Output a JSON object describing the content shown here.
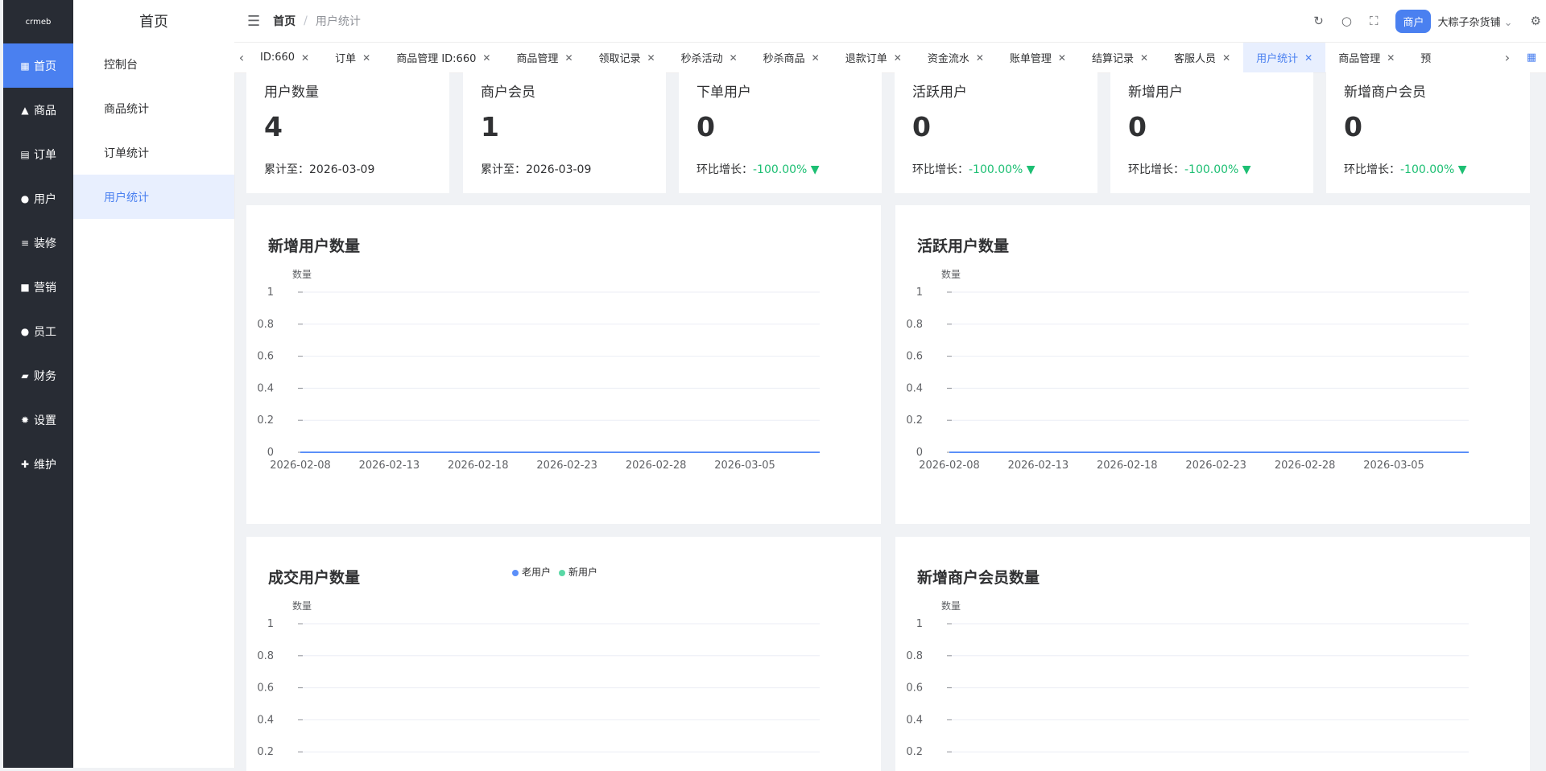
{
  "rail": {
    "logo": "crmeb",
    "items": [
      {
        "label": "首页",
        "icon": "grid-icon",
        "active": true
      },
      {
        "label": "商品",
        "icon": "bag-icon"
      },
      {
        "label": "订单",
        "icon": "doc-icon"
      },
      {
        "label": "用户",
        "icon": "user-icon"
      },
      {
        "label": "装修",
        "icon": "sliders-icon"
      },
      {
        "label": "营销",
        "icon": "shop-icon"
      },
      {
        "label": "员工",
        "icon": "staff-icon"
      },
      {
        "label": "财务",
        "icon": "wallet-icon"
      },
      {
        "label": "设置",
        "icon": "gear-icon"
      },
      {
        "label": "维护",
        "icon": "wrench-icon"
      }
    ]
  },
  "submenu": {
    "title": "首页",
    "items": [
      {
        "label": "控制台"
      },
      {
        "label": "商品统计"
      },
      {
        "label": "订单统计"
      },
      {
        "label": "用户统计",
        "active": true
      }
    ]
  },
  "header": {
    "breadcrumb_home": "首页",
    "breadcrumb_sep": "/",
    "breadcrumb_current": "用户统计",
    "merchant_badge": "商户",
    "shop_name": "大粽子杂货铺"
  },
  "tabs": [
    {
      "label": "ID:660"
    },
    {
      "label": "订单"
    },
    {
      "label": "商品管理 ID:660"
    },
    {
      "label": "商品管理"
    },
    {
      "label": "领取记录"
    },
    {
      "label": "秒杀活动"
    },
    {
      "label": "秒杀商品"
    },
    {
      "label": "退款订单"
    },
    {
      "label": "资金流水"
    },
    {
      "label": "账单管理"
    },
    {
      "label": "结算记录"
    },
    {
      "label": "客服人员"
    },
    {
      "label": "用户统计",
      "active": true
    },
    {
      "label": "商品管理"
    },
    {
      "label": "预"
    }
  ],
  "stats": [
    {
      "label": "用户数量",
      "value": "4",
      "foot_label": "累计至：",
      "foot_value": "2026-03-09"
    },
    {
      "label": "商户会员",
      "value": "1",
      "foot_label": "累计至：",
      "foot_value": "2026-03-09"
    },
    {
      "label": "下单用户",
      "value": "0",
      "foot_label": "环比增长：",
      "foot_value": "-100.00%",
      "trend": "down"
    },
    {
      "label": "活跃用户",
      "value": "0",
      "foot_label": "环比增长：",
      "foot_value": "-100.00%",
      "trend": "down"
    },
    {
      "label": "新增用户",
      "value": "0",
      "foot_label": "环比增长：",
      "foot_value": "-100.00%",
      "trend": "down"
    },
    {
      "label": "新增商户会员",
      "value": "0",
      "foot_label": "环比增长：",
      "foot_value": "-100.00%",
      "trend": "down"
    }
  ],
  "panels": [
    {
      "title": "新增用户数量"
    },
    {
      "title": "活跃用户数量"
    },
    {
      "title": "成交用户数量",
      "legend": [
        {
          "name": "老用户",
          "color": "#5b8ff9"
        },
        {
          "name": "新用户",
          "color": "#5ad8a6"
        }
      ]
    },
    {
      "title": "新增商户会员数量"
    }
  ],
  "chart_data": [
    {
      "type": "line",
      "title": "新增用户数量",
      "ylabel": "数量",
      "ylim": [
        0,
        1
      ],
      "yticks": [
        "1",
        "0.8",
        "0.6",
        "0.4",
        "0.2",
        "0"
      ],
      "xticks": [
        "2026-02-08",
        "2026-02-13",
        "2026-02-18",
        "2026-02-23",
        "2026-02-28",
        "2026-03-05"
      ],
      "series": [
        {
          "color": "#5b8ff9",
          "values": [
            0,
            0
          ]
        }
      ]
    },
    {
      "type": "line",
      "title": "活跃用户数量",
      "ylabel": "数量",
      "ylim": [
        0,
        1
      ],
      "yticks": [
        "1",
        "0.8",
        "0.6",
        "0.4",
        "0.2",
        "0"
      ],
      "xticks": [
        "2026-02-08",
        "2026-02-13",
        "2026-02-18",
        "2026-02-23",
        "2026-02-28",
        "2026-03-05"
      ],
      "series": [
        {
          "color": "#5b8ff9",
          "values": [
            0,
            0
          ]
        }
      ]
    },
    {
      "type": "line",
      "title": "成交用户数量",
      "ylabel": "数量",
      "ylim": [
        0,
        1
      ],
      "yticks": [
        "1",
        "0.8",
        "0.6",
        "0.4",
        "0.2"
      ],
      "xticks": [],
      "series": [
        {
          "name": "老用户",
          "color": "#5b8ff9",
          "values": []
        },
        {
          "name": "新用户",
          "color": "#5ad8a6",
          "values": []
        }
      ]
    },
    {
      "type": "line",
      "title": "新增商户会员数量",
      "ylabel": "数量",
      "ylim": [
        0,
        1
      ],
      "yticks": [
        "1",
        "0.8",
        "0.6",
        "0.4",
        "0.2"
      ],
      "xticks": [],
      "series": []
    }
  ],
  "colors": {
    "accent": "#4a80f0",
    "rail": "#282c34",
    "down": "#1dbf73"
  }
}
